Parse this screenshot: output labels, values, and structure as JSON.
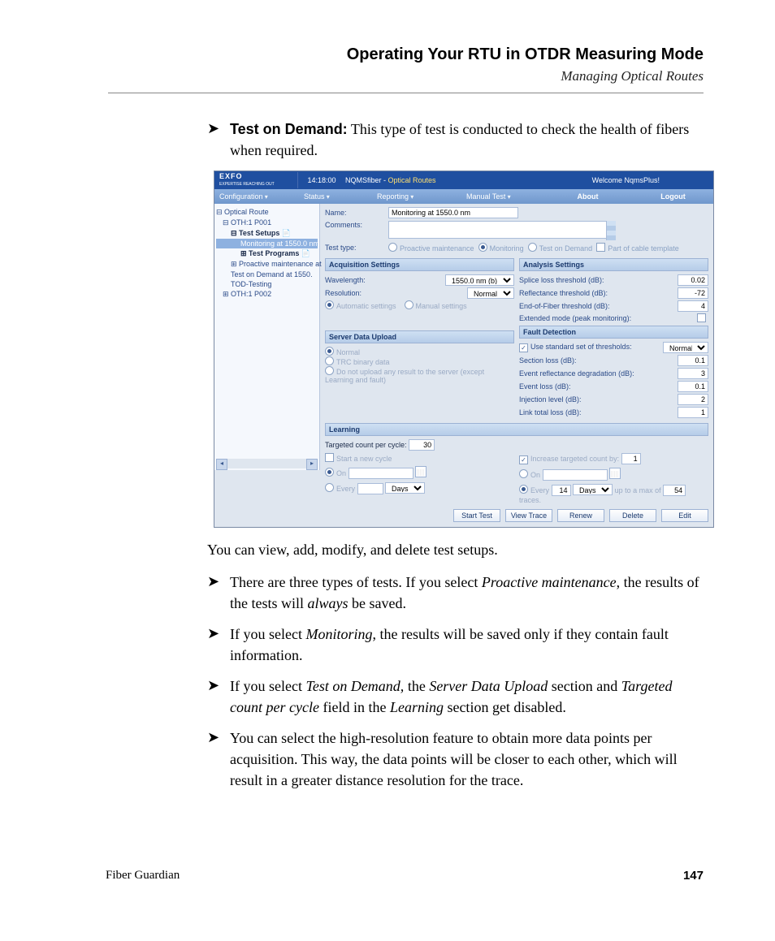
{
  "page": {
    "title": "Operating Your RTU in OTDR Measuring Mode",
    "subtitle": "Managing Optical Routes",
    "footer_left": "Fiber Guardian",
    "footer_right": "147"
  },
  "text": {
    "b1_label": "Test on Demand:",
    "b1_rest": " This type of test is conducted to check the health of fibers when required.",
    "para1": "You can view, add, modify, and delete test setups.",
    "b2_a": "There are three types of tests. If you select ",
    "b2_i1": "Proactive maintenance",
    "b2_b": ", the results of the tests will ",
    "b2_i2": "always",
    "b2_c": " be saved.",
    "b3_a": "If you select ",
    "b3_i1": "Monitoring",
    "b3_b": ", the results will be saved only if they contain fault information.",
    "b4_a": "If you select ",
    "b4_i1": "Test on Demand,",
    "b4_b": " the ",
    "b4_i2": "Server Data Upload",
    "b4_c": " section and ",
    "b4_i3": "Targeted count per cycle",
    "b4_d": " field in the ",
    "b4_i4": "Learning",
    "b4_e": " section get disabled.",
    "b5": "You can select the high-resolution feature to obtain more data points per acquisition. This way, the data points will be closer to each other, which will result in a greater distance resolution for the trace."
  },
  "shot": {
    "logo": "EXFO",
    "logo_sub": "EXPERTISE REACHING OUT",
    "time": "14:18:00",
    "crumb_a": "NQMSfiber - ",
    "crumb_b": "Optical Routes",
    "welcome": "Welcome NqmsPlus!",
    "menu": {
      "config": "Configuration",
      "status": "Status",
      "reporting": "Reporting",
      "manual": "Manual Test",
      "about": "About",
      "logout": "Logout"
    },
    "tree": {
      "r0": "Optical Route",
      "r1": "OTH:1 P001",
      "r2": "Test Setups",
      "r3": "Monitoring at 1550.0 nm",
      "r4": "Test Programs",
      "r5": "Proactive maintenance at",
      "r6": "Test on Demand at 1550.",
      "r7": "TOD-Testing",
      "r8": "OTH:1 P002"
    },
    "form": {
      "name_lab": "Name:",
      "name_val": "Monitoring at 1550.0 nm",
      "comments_lab": "Comments:",
      "type_lab": "Test type:",
      "type_pm": "Proactive maintenance",
      "type_mon": "Monitoring",
      "type_tod": "Test on Demand",
      "type_part": "Part of cable template"
    },
    "acq": {
      "head": "Acquisition Settings",
      "wavelength_lab": "Wavelength:",
      "wavelength_val": "1550.0 nm (b)",
      "resolution_lab": "Resolution:",
      "resolution_val": "Normal",
      "auto": "Automatic settings",
      "manual": "Manual settings"
    },
    "ana": {
      "head": "Analysis Settings",
      "splice": "Splice loss threshold (dB):",
      "splice_v": "0.02",
      "refl": "Reflectance threshold (dB):",
      "refl_v": "-72",
      "eof": "End-of-Fiber threshold (dB):",
      "eof_v": "4",
      "ext": "Extended mode (peak monitoring):"
    },
    "fault": {
      "head": "Fault Detection",
      "std": "Use standard set of thresholds:",
      "std_v": "Normal",
      "sec": "Section loss (dB):",
      "sec_v": "0.1",
      "erd": "Event reflectance degradation (dB):",
      "erd_v": "3",
      "ev": "Event loss (dB):",
      "ev_v": "0.1",
      "inj": "Injection level (dB):",
      "inj_v": "2",
      "link": "Link total loss (dB):",
      "link_v": "1"
    },
    "upload": {
      "head": "Server Data Upload",
      "normal": "Normal",
      "trc": "TRC binary data",
      "none": "Do not upload any result to the server (except Learning and fault)"
    },
    "learn": {
      "head": "Learning",
      "target_lab": "Targeted count per cycle:",
      "target_v": "30",
      "start": "Start a new cycle",
      "on": "On",
      "every": "Every",
      "days": "Days",
      "incr": "Increase targeted count by:",
      "incr_v": "1",
      "incr_every_v": "14",
      "upto": "up to a max of",
      "upto_v": "54",
      "traces": "traces."
    },
    "buttons": {
      "start": "Start Test",
      "view": "View Trace",
      "renew": "Renew",
      "delete": "Delete",
      "edit": "Edit"
    }
  }
}
